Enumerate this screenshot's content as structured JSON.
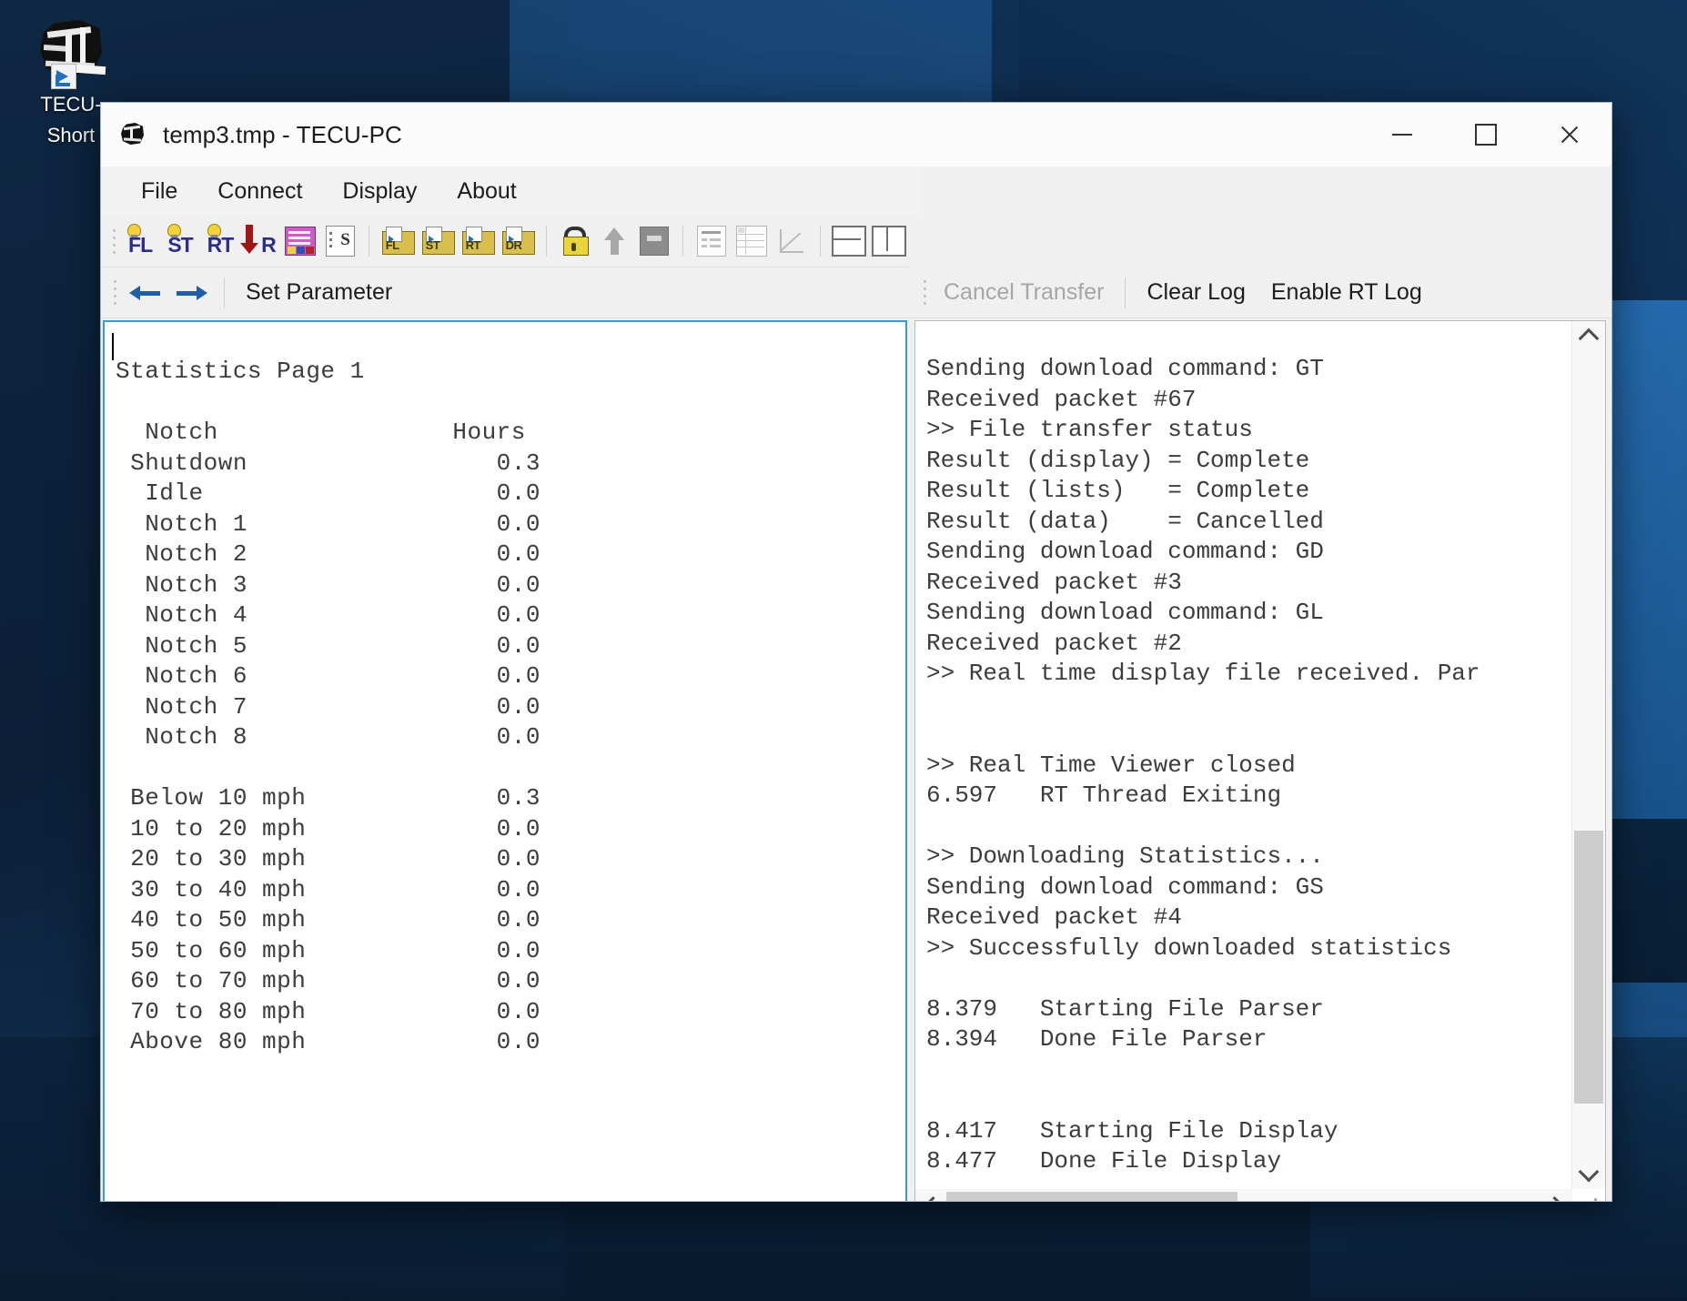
{
  "desktop": {
    "icon": {
      "name": "tecu-shortcut-icon",
      "label_line1": "TECU-",
      "label_line2": "Short"
    }
  },
  "window": {
    "title": "temp3.tmp - TECU-PC",
    "app_icon": "tecu-app-icon",
    "controls": {
      "minimize": "minimize-icon",
      "maximize": "maximize-icon",
      "close": "close-icon"
    }
  },
  "menubar": {
    "items": [
      {
        "label": "File"
      },
      {
        "label": "Connect"
      },
      {
        "label": "Display"
      },
      {
        "label": "About"
      }
    ]
  },
  "toolbar": {
    "buttons": [
      {
        "icon": "fault-list-icon",
        "text": "FL"
      },
      {
        "icon": "statistics-icon",
        "text": "ST"
      },
      {
        "icon": "realtime-icon",
        "text": "RT"
      },
      {
        "icon": "download-r-icon",
        "text": "R"
      },
      {
        "icon": "color-table-icon",
        "text": ""
      },
      {
        "icon": "snapshot-document-icon",
        "text": "S"
      },
      {
        "icon": "open-fault-list-folder-icon",
        "text": "FL"
      },
      {
        "icon": "open-statistics-folder-icon",
        "text": "ST"
      },
      {
        "icon": "open-realtime-folder-icon",
        "text": "RT"
      },
      {
        "icon": "open-data-recorder-folder-icon",
        "text": "DR"
      },
      {
        "icon": "unlock-padlock-icon",
        "text": ""
      },
      {
        "icon": "upload-arrow-icon",
        "text": ""
      },
      {
        "icon": "grey-panel-icon",
        "text": ""
      },
      {
        "icon": "list-view-icon",
        "text": ""
      },
      {
        "icon": "grid-view-icon",
        "text": ""
      },
      {
        "icon": "chart-view-icon",
        "text": ""
      },
      {
        "icon": "split-horizontal-icon",
        "text": ""
      },
      {
        "icon": "split-vertical-icon",
        "text": ""
      }
    ]
  },
  "nav": {
    "back_icon": "arrow-left-icon",
    "forward_icon": "arrow-right-icon",
    "set_parameter_label": "Set Parameter"
  },
  "log_toolbar": {
    "cancel_transfer_label": "Cancel Transfer",
    "clear_log_label": "Clear Log",
    "enable_rt_log_label": "Enable RT Log"
  },
  "statistics_panel": {
    "heading": "Statistics Page 1",
    "columns": {
      "left": "Notch",
      "right": "Hours"
    },
    "notch_rows": [
      {
        "label": "Shutdown",
        "hours": "0.3"
      },
      {
        "label": "Idle",
        "hours": "0.0"
      },
      {
        "label": "Notch 1",
        "hours": "0.0"
      },
      {
        "label": "Notch 2",
        "hours": "0.0"
      },
      {
        "label": "Notch 3",
        "hours": "0.0"
      },
      {
        "label": "Notch 4",
        "hours": "0.0"
      },
      {
        "label": "Notch 5",
        "hours": "0.0"
      },
      {
        "label": "Notch 6",
        "hours": "0.0"
      },
      {
        "label": "Notch 7",
        "hours": "0.0"
      },
      {
        "label": "Notch 8",
        "hours": "0.0"
      }
    ],
    "speed_rows": [
      {
        "label": "Below 10 mph",
        "hours": "0.3"
      },
      {
        "label": "10 to 20 mph",
        "hours": "0.0"
      },
      {
        "label": "20 to 30 mph",
        "hours": "0.0"
      },
      {
        "label": "30 to 40 mph",
        "hours": "0.0"
      },
      {
        "label": "40 to 50 mph",
        "hours": "0.0"
      },
      {
        "label": "50 to 60 mph",
        "hours": "0.0"
      },
      {
        "label": "60 to 70 mph",
        "hours": "0.0"
      },
      {
        "label": "70 to 80 mph",
        "hours": "0.0"
      },
      {
        "label": "Above 80 mph",
        "hours": "0.0"
      }
    ],
    "rendered_text": "Statistics Page 1\n\n  Notch                Hours\n Shutdown                 0.3\n  Idle                    0.0\n  Notch 1                 0.0\n  Notch 2                 0.0\n  Notch 3                 0.0\n  Notch 4                 0.0\n  Notch 5                 0.0\n  Notch 6                 0.0\n  Notch 7                 0.0\n  Notch 8                 0.0\n\n Below 10 mph             0.3\n 10 to 20 mph             0.0\n 20 to 30 mph             0.0\n 30 to 40 mph             0.0\n 40 to 50 mph             0.0\n 50 to 60 mph             0.0\n 60 to 70 mph             0.0\n 70 to 80 mph             0.0\n Above 80 mph             0.0"
  },
  "log_panel": {
    "lines": [
      "Sending download command: GT",
      "Received packet #67",
      ">> File transfer status",
      "Result (display) = Complete",
      "Result (lists)   = Complete",
      "Result (data)    = Cancelled",
      "Sending download command: GD",
      "Received packet #3",
      "Sending download command: GL",
      "Received packet #2",
      ">> Real time display file received. Par",
      "",
      "",
      ">> Real Time Viewer closed",
      "6.597   RT Thread Exiting",
      "",
      ">> Downloading Statistics...",
      "Sending download command: GS",
      "Received packet #4",
      ">> Successfully downloaded statistics",
      "",
      "8.379   Starting File Parser",
      "8.394   Done File Parser",
      "",
      "",
      "8.417   Starting File Display",
      "8.477   Done File Display"
    ],
    "rendered_text": "Sending download command: GT\nReceived packet #67\n>> File transfer status\nResult (display) = Complete\nResult (lists)   = Complete\nResult (data)    = Cancelled\nSending download command: GD\nReceived packet #3\nSending download command: GL\nReceived packet #2\n>> Real time display file received. Par\n\n\n>> Real Time Viewer closed\n6.597   RT Thread Exiting\n\n>> Downloading Statistics...\nSending download command: GS\nReceived packet #4\n>> Successfully downloaded statistics\n\n8.379   Starting File Parser\n8.394   Done File Parser\n\n\n8.417   Starting File Display\n8.477   Done File Display",
    "scrollbars": {
      "vertical_up_icon": "chevron-up-icon",
      "vertical_down_icon": "chevron-down-icon",
      "horizontal_left_icon": "chevron-left-icon",
      "horizontal_right_icon": "chevron-right-icon",
      "resize_grip_icon": "resize-grip-icon"
    }
  },
  "colors": {
    "accent_blue": "#3a9ad9",
    "title_text": "#1b1b1b",
    "mono_text": "#3c3c3c",
    "toolbar_bg": "#f0f0f0",
    "desktop_blue": "#123c66"
  }
}
